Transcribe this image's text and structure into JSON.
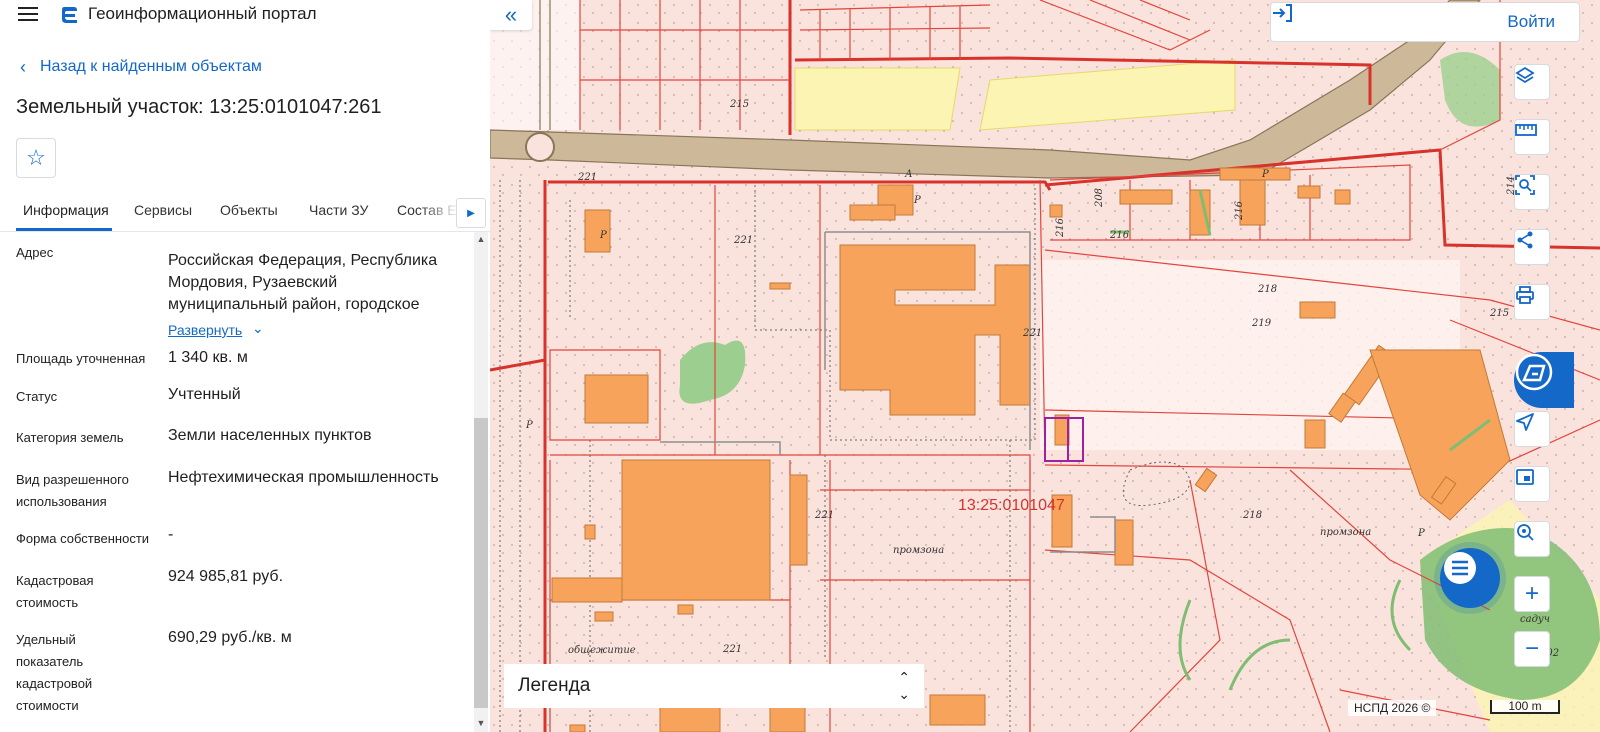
{
  "app": {
    "title": "Геоинформационный портал"
  },
  "nav": {
    "back_label": "Назад к найденным объектам"
  },
  "object": {
    "title": "Земельный участок: 13:25:0101047:261"
  },
  "tabs": [
    {
      "label": "Информация"
    },
    {
      "label": "Сервисы"
    },
    {
      "label": "Объекты"
    },
    {
      "label": "Части ЗУ"
    },
    {
      "label": "Состав Е"
    }
  ],
  "info": {
    "address": {
      "label": "Адрес",
      "value": "Российская Федерация, Республика Мордовия, Рузаевский муниципальный район, городское",
      "expand": "Развернуть"
    },
    "area": {
      "label": "Площадь уточненная",
      "value": "1 340 кв. м"
    },
    "status": {
      "label": "Статус",
      "value": "Учтенный"
    },
    "category": {
      "label": "Категория земель",
      "value": "Земли населенных пунктов"
    },
    "permitted_use": {
      "label": "Вид разрешенного использования",
      "value": "Нефтехимическая промышленность"
    },
    "ownership": {
      "label": "Форма собственности",
      "value": "-"
    },
    "cadastral_value": {
      "label": "Кадастровая стоимость",
      "value": "924 985,81 руб."
    },
    "unit_value": {
      "label": "Удельный показатель кадастровой стоимости",
      "value": "690,29 руб./кв. м"
    }
  },
  "map": {
    "cadastral_block": "13:25:0101047",
    "labels": {
      "l215a": "215",
      "l221a": "221",
      "l221b": "221",
      "l221c": "221",
      "l221d": "221",
      "l221e": "221",
      "l216a": "216",
      "l216b": "216",
      "l216c": "216",
      "l218a": "218",
      "l218b": "218",
      "l219": "219",
      "l215b": "215",
      "l202": "202",
      "l214": "214",
      "l208": "208",
      "promzona1": "промзона",
      "promzona2": "промзона",
      "obshch": "общежитие",
      "sady": "садуч",
      "p1": "Р",
      "p2": "Р",
      "p3": "Р",
      "p4": "Р",
      "p5": "Р",
      "a": "А"
    },
    "login_label": "Войти",
    "legend_label": "Легенда",
    "attribution": "НСПД 2026 ©",
    "scale_label": "100 m"
  },
  "icons": {
    "menu": "menu-icon",
    "logo": "portal-logo",
    "back": "chevron-left-icon",
    "star": "star-icon",
    "tab_next": "chevron-right-icon",
    "collapse": "double-chevron-left-icon",
    "login": "login-icon",
    "layers": "layers-icon",
    "ruler": "ruler-icon",
    "select": "area-select-icon",
    "share": "share-icon",
    "print": "print-icon",
    "assistant": "assistant-icon",
    "locate": "navigation-arrow-icon",
    "minimap": "minimap-icon",
    "search_point": "point-search-icon",
    "zoom_in": "plus-icon",
    "zoom_out": "minus-icon",
    "chat": "chat-icon",
    "legend_toggle": "sort-toggle-icon"
  },
  "colors": {
    "accent": "#1468c8",
    "map_background": "#fbe3dd",
    "building": "#f7a35c",
    "boundary": "#d8322b",
    "road": "#cdb99a",
    "vegetation": "#9ccf8f",
    "yellow_zone": "#fbf4b2",
    "selected_parcel": "#a020a0"
  }
}
